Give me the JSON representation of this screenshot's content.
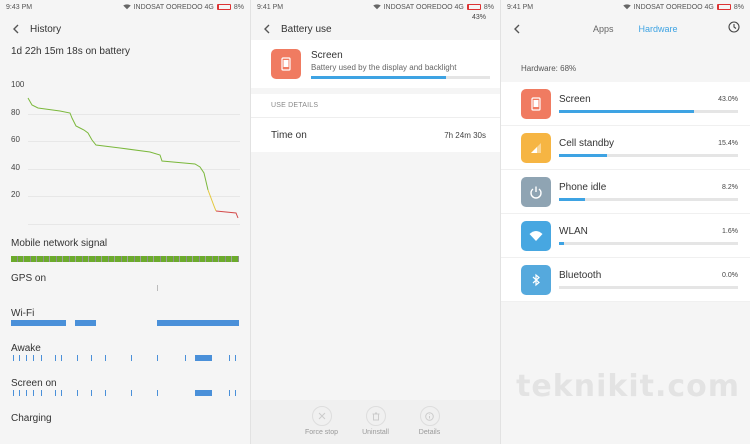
{
  "status": {
    "time1": "9:43 PM",
    "time2": "9:41 PM",
    "time3": "9:41 PM",
    "carrier": "INDOSAT OOREDOO 4G",
    "battery": "8%"
  },
  "history": {
    "title": "History",
    "on_battery": "1d 22h 15m 18s on battery",
    "y_labels": [
      "100",
      "80",
      "60",
      "40",
      "20"
    ],
    "rows": [
      "Mobile network signal",
      "GPS on",
      "Wi-Fi",
      "Awake",
      "Screen on",
      "Charging"
    ]
  },
  "battery_use": {
    "title": "Battery use",
    "app_name": "Screen",
    "app_desc": "Battery used by the display and backlight",
    "percent": "43%",
    "usage_fraction": 0.43,
    "details_header": "USE DETAILS",
    "time_on_label": "Time on",
    "time_on_value": "7h 24m 30s",
    "actions": [
      "Force stop",
      "Uninstall",
      "Details"
    ]
  },
  "hardware": {
    "tabs": [
      "Apps",
      "Hardware"
    ],
    "summary": "Hardware: 68%",
    "items": [
      {
        "name": "Screen",
        "pct": "43.0%",
        "fraction": 0.43,
        "color": "#f07b61",
        "icon": "tablet-icon"
      },
      {
        "name": "Cell standby",
        "pct": "15.4%",
        "fraction": 0.154,
        "color": "#f6b543",
        "icon": "signal-icon"
      },
      {
        "name": "Phone idle",
        "pct": "8.2%",
        "fraction": 0.082,
        "color": "#8fa4b3",
        "icon": "power-icon"
      },
      {
        "name": "WLAN",
        "pct": "1.6%",
        "fraction": 0.016,
        "color": "#47a7e1",
        "icon": "wifi-icon"
      },
      {
        "name": "Bluetooth",
        "pct": "0.0%",
        "fraction": 0.0,
        "color": "#55a9dd",
        "icon": "bluetooth-icon"
      }
    ]
  },
  "watermark": "teknikit.com"
}
